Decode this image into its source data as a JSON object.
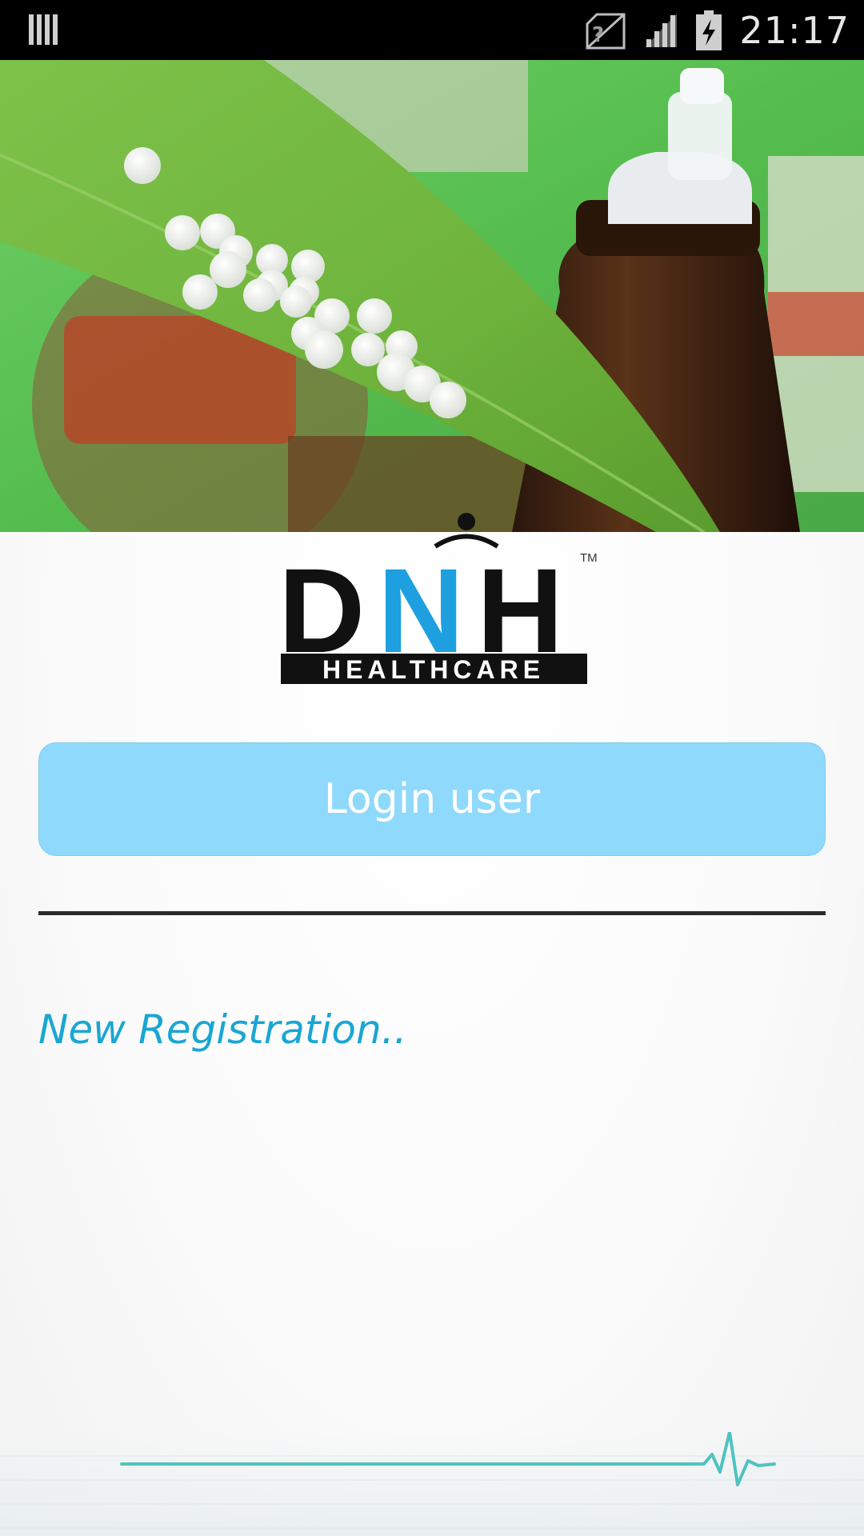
{
  "status_bar": {
    "time": "21:17",
    "icons": [
      "notification-icon",
      "no-sim-icon",
      "signal-icon",
      "battery-charging-icon"
    ]
  },
  "hero": {
    "description_icon": "homeopathy-pills-image"
  },
  "logo": {
    "letters_left": "D",
    "letter_accent": "N",
    "letters_right": "H",
    "subtitle": "HEALTHCARE",
    "trademark": "TM"
  },
  "login": {
    "label": "Login user"
  },
  "registration": {
    "label": "New Registration.."
  },
  "colors": {
    "button_bg": "#8fd9fc",
    "link": "#1aa6d3",
    "heartbeat": "#4fc3c0",
    "logo_accent": "#1e9fe0"
  }
}
